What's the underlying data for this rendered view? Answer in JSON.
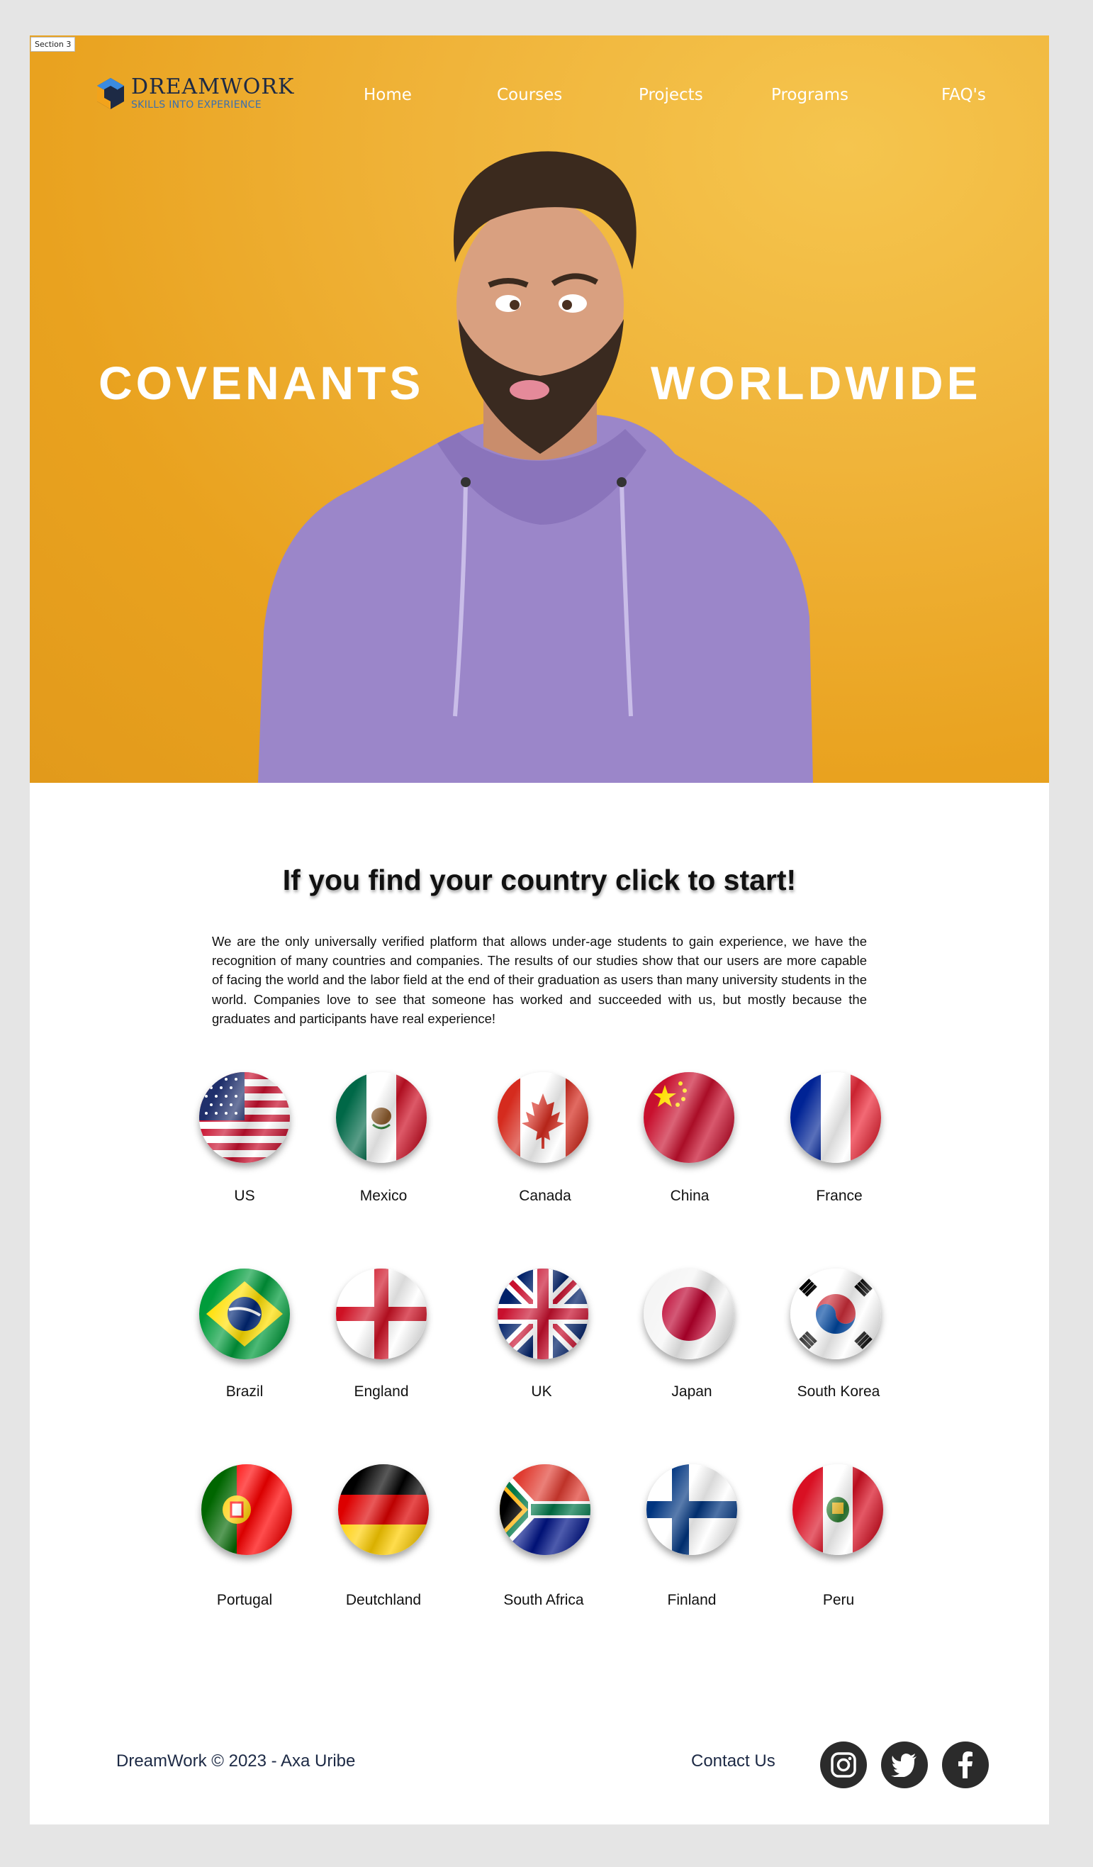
{
  "frame_label": "Section 3",
  "brand": {
    "name": "DREAMWORK",
    "tagline": "SKILLS INTO EXPERIENCE"
  },
  "nav": [
    "Home",
    "Courses",
    "Projects",
    "Programs",
    "FAQ's"
  ],
  "hero": {
    "left_word": "COVENANTS",
    "right_word": "WORLDWIDE",
    "image": "man-in-purple-hoodie-photo"
  },
  "headline": "If you find your country click to start!",
  "intro": "We are the only universally verified platform that allows under-age students to gain experience, we have the recognition of many countries and companies. The results of our studies show that our users are more capable of facing the world and the labor field at the end of their graduation as users than many university students in the world. Companies love to see that someone has worked and succeeded with us, but mostly because the graduates and participants have real experience!",
  "countries": [
    "US",
    "Mexico",
    "Canada",
    "China",
    "France",
    "Brazil",
    "England",
    "UK",
    "Japan",
    "South Korea",
    "Portugal",
    "Deutchland",
    "South Africa",
    "Finland",
    "Peru"
  ],
  "footer": {
    "copyright": "DreamWork © 2023 - Axa Uribe",
    "contact": "Contact Us",
    "social_icons": [
      "instagram-icon",
      "twitter-icon",
      "facebook-icon"
    ]
  },
  "colors": {
    "hero_bg": "#eeaa2c",
    "hoodie": "#9b86c9",
    "brand_blue": "#3a6fb0",
    "footer_text": "#1d2a45"
  }
}
